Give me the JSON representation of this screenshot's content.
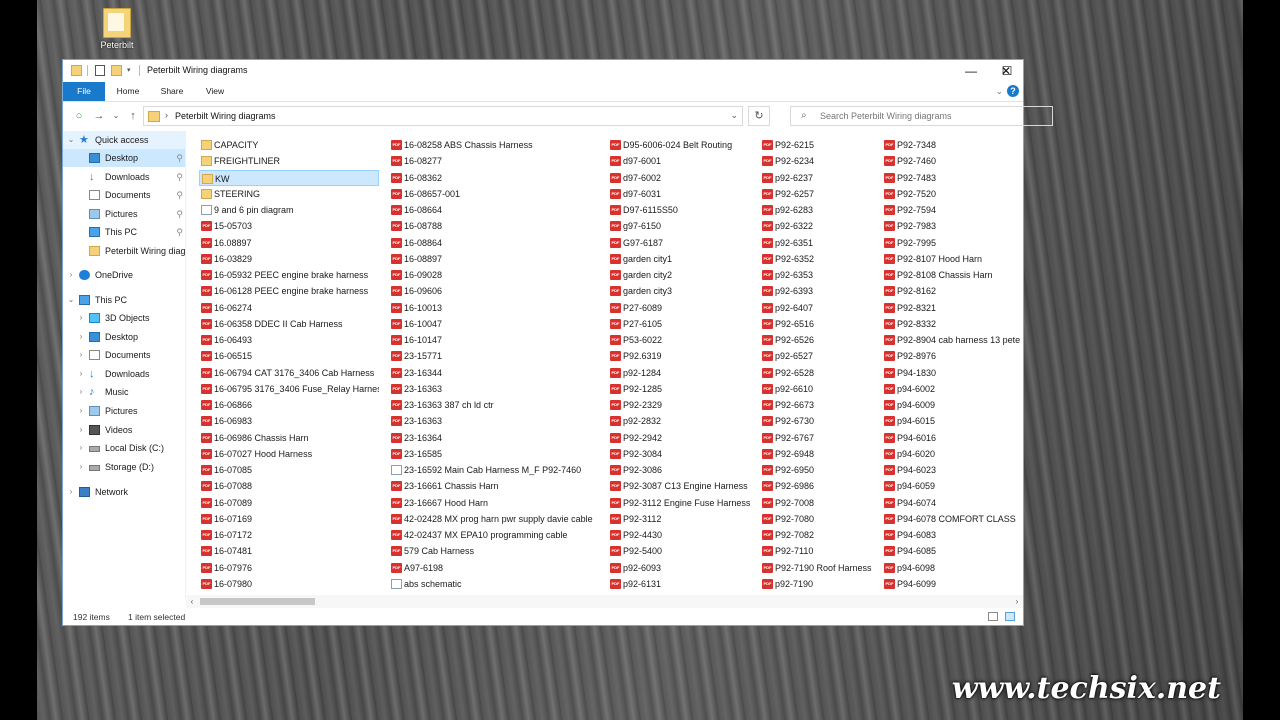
{
  "desktop": {
    "icon_label": "Peterbilt",
    "watermark": "www.techsix.net"
  },
  "window": {
    "title": "Peterbilt Wiring diagrams",
    "buttons": [
      "—",
      "☐",
      "✕"
    ]
  },
  "ribbon": {
    "tabs": [
      "File",
      "Home",
      "Share",
      "View"
    ]
  },
  "address_bar": {
    "path": "Peterbilt Wiring diagrams",
    "search_placeholder": "Search Peterbilt Wiring diagrams"
  },
  "nav_pane": {
    "items": [
      {
        "label": "Quick access",
        "icon": "star-icon",
        "level": 0,
        "state": "expanded",
        "pinned": false
      },
      {
        "label": "Desktop",
        "icon": "desktop-icon",
        "level": 1,
        "state": "",
        "pinned": true,
        "selected": true
      },
      {
        "label": "Downloads",
        "icon": "download-icon",
        "level": 1,
        "state": "",
        "pinned": true
      },
      {
        "label": "Documents",
        "icon": "documents-icon",
        "level": 1,
        "state": "",
        "pinned": true
      },
      {
        "label": "Pictures",
        "icon": "pictures-icon",
        "level": 1,
        "state": "",
        "pinned": true
      },
      {
        "label": "This PC",
        "icon": "pc-icon",
        "level": 1,
        "state": "",
        "pinned": true
      },
      {
        "label": "Peterbilt Wiring diagrams",
        "icon": "folder-icon",
        "level": 1,
        "state": "",
        "pinned": false
      },
      {
        "label": "OneDrive",
        "icon": "cloud-icon",
        "level": 0,
        "state": "collapsed",
        "pinned": false
      },
      {
        "label": "This PC",
        "icon": "pc-icon",
        "level": 0,
        "state": "expanded",
        "pinned": false
      },
      {
        "label": "3D Objects",
        "icon": "3d-objects-icon",
        "level": 1,
        "state": "collapsed",
        "pinned": false
      },
      {
        "label": "Desktop",
        "icon": "desktop-icon",
        "level": 1,
        "state": "collapsed",
        "pinned": false
      },
      {
        "label": "Documents",
        "icon": "documents-icon",
        "level": 1,
        "state": "collapsed",
        "pinned": false
      },
      {
        "label": "Downloads",
        "icon": "download-icon",
        "level": 1,
        "state": "collapsed",
        "pinned": false
      },
      {
        "label": "Music",
        "icon": "music-icon",
        "level": 1,
        "state": "collapsed",
        "pinned": false
      },
      {
        "label": "Pictures",
        "icon": "pictures-icon",
        "level": 1,
        "state": "collapsed",
        "pinned": false
      },
      {
        "label": "Videos",
        "icon": "videos-icon",
        "level": 1,
        "state": "collapsed",
        "pinned": false
      },
      {
        "label": "Local Disk (C:)",
        "icon": "drive-icon",
        "level": 1,
        "state": "collapsed",
        "pinned": false
      },
      {
        "label": "Storage (D:)",
        "icon": "drive-icon",
        "level": 1,
        "state": "collapsed",
        "pinned": false
      },
      {
        "label": "Network",
        "icon": "network-icon",
        "level": 0,
        "state": "collapsed",
        "pinned": false
      }
    ]
  },
  "content": {
    "columns": [
      [
        {
          "name": "CAPACITY",
          "type": "folder"
        },
        {
          "name": "FREIGHTLINER",
          "type": "folder"
        },
        {
          "name": "KW",
          "type": "folder",
          "selected": true
        },
        {
          "name": "STEERING",
          "type": "folder"
        },
        {
          "name": "9 and 6 pin diagram",
          "type": "file"
        },
        {
          "name": "15-05703",
          "type": "pdf"
        },
        {
          "name": "16.08897",
          "type": "pdf"
        },
        {
          "name": "16-03829",
          "type": "pdf"
        },
        {
          "name": "16-05932 PEEC engine brake harness",
          "type": "pdf"
        },
        {
          "name": "16-06128 PEEC engine brake harness",
          "type": "pdf"
        },
        {
          "name": "16-06274",
          "type": "pdf"
        },
        {
          "name": "16-06358 DDEC II Cab Harness",
          "type": "pdf"
        },
        {
          "name": "16-06493",
          "type": "pdf"
        },
        {
          "name": "16-06515",
          "type": "pdf"
        },
        {
          "name": "16-06794 CAT 3176_3406 Cab Harness",
          "type": "pdf"
        },
        {
          "name": "16-06795 3176_3406 Fuse_Relay Harness",
          "type": "pdf"
        },
        {
          "name": "16-06866",
          "type": "pdf"
        },
        {
          "name": "16-06983",
          "type": "pdf"
        },
        {
          "name": "16-06986 Chassis Harn",
          "type": "pdf"
        },
        {
          "name": "16-07027 Hood Harness",
          "type": "pdf"
        },
        {
          "name": "16-07085",
          "type": "pdf"
        },
        {
          "name": "16-07088",
          "type": "pdf"
        },
        {
          "name": "16-07089",
          "type": "pdf"
        },
        {
          "name": "16-07169",
          "type": "pdf"
        },
        {
          "name": "16-07172",
          "type": "pdf"
        },
        {
          "name": "16-07481",
          "type": "pdf"
        },
        {
          "name": "16-07976",
          "type": "pdf"
        },
        {
          "name": "16-07980",
          "type": "pdf"
        }
      ],
      [
        {
          "name": "16-08258 ABS Chassis Harness",
          "type": "pdf"
        },
        {
          "name": "16-08277",
          "type": "pdf"
        },
        {
          "name": "16-08362",
          "type": "pdf"
        },
        {
          "name": "16-08657-001",
          "type": "pdf"
        },
        {
          "name": "16-08664",
          "type": "pdf"
        },
        {
          "name": "16-08788",
          "type": "pdf"
        },
        {
          "name": "16-08864",
          "type": "pdf"
        },
        {
          "name": "16-08897",
          "type": "pdf"
        },
        {
          "name": "16-09028",
          "type": "pdf"
        },
        {
          "name": "16-09606",
          "type": "pdf"
        },
        {
          "name": "16-10013",
          "type": "pdf"
        },
        {
          "name": "16-10047",
          "type": "pdf"
        },
        {
          "name": "16-10147",
          "type": "pdf"
        },
        {
          "name": "23-15771",
          "type": "pdf"
        },
        {
          "name": "23-16344",
          "type": "pdf"
        },
        {
          "name": "23-16363",
          "type": "pdf"
        },
        {
          "name": "23-16363 387 ch ld ctr",
          "type": "pdf"
        },
        {
          "name": "23-16363",
          "type": "pdf"
        },
        {
          "name": "23-16364",
          "type": "pdf"
        },
        {
          "name": "23-16585",
          "type": "pdf"
        },
        {
          "name": "23-16592 Main Cab Harness M_F P92-7460",
          "type": "file"
        },
        {
          "name": "23-16661 Chassis Harn",
          "type": "pdf"
        },
        {
          "name": "23-16667 Hood Harn",
          "type": "pdf"
        },
        {
          "name": "42-02428 MX prog harn pwr supply davie cable",
          "type": "pdf"
        },
        {
          "name": "42-02437 MX EPA10 programming cable",
          "type": "pdf"
        },
        {
          "name": "579 Cab Harness",
          "type": "pdf"
        },
        {
          "name": "A97-6198",
          "type": "pdf"
        },
        {
          "name": "abs schematic",
          "type": "file"
        }
      ],
      [
        {
          "name": "D95-6006-024 Belt Routing",
          "type": "pdf"
        },
        {
          "name": "d97-6001",
          "type": "pdf"
        },
        {
          "name": "d97-6002",
          "type": "pdf"
        },
        {
          "name": "d97-6031",
          "type": "pdf"
        },
        {
          "name": "D97-6115S50",
          "type": "pdf"
        },
        {
          "name": "g97-6150",
          "type": "pdf"
        },
        {
          "name": "G97-6187",
          "type": "pdf"
        },
        {
          "name": "garden city1",
          "type": "pdf"
        },
        {
          "name": "garden city2",
          "type": "pdf"
        },
        {
          "name": "garden city3",
          "type": "pdf"
        },
        {
          "name": "P27-6089",
          "type": "pdf"
        },
        {
          "name": "P27-6105",
          "type": "pdf"
        },
        {
          "name": "P53-6022",
          "type": "pdf"
        },
        {
          "name": "P92.6319",
          "type": "pdf"
        },
        {
          "name": "p92-1284",
          "type": "pdf"
        },
        {
          "name": "P92-1285",
          "type": "pdf"
        },
        {
          "name": "P92-2329",
          "type": "pdf"
        },
        {
          "name": "p92-2832",
          "type": "pdf"
        },
        {
          "name": "P92-2942",
          "type": "pdf"
        },
        {
          "name": "P92-3084",
          "type": "pdf"
        },
        {
          "name": "P92-3086",
          "type": "pdf"
        },
        {
          "name": "P92-3087 C13 Engine Harness",
          "type": "pdf"
        },
        {
          "name": "P92-3112 Engine Fuse Harness",
          "type": "pdf"
        },
        {
          "name": "P92-3112",
          "type": "pdf"
        },
        {
          "name": "P92-4430",
          "type": "pdf"
        },
        {
          "name": "P92-5400",
          "type": "pdf"
        },
        {
          "name": "p92-6093",
          "type": "pdf"
        },
        {
          "name": "p92-6131",
          "type": "pdf"
        }
      ],
      [
        {
          "name": "P92-6215",
          "type": "pdf"
        },
        {
          "name": "P92-6234",
          "type": "pdf"
        },
        {
          "name": "p92-6237",
          "type": "pdf"
        },
        {
          "name": "P92-6257",
          "type": "pdf"
        },
        {
          "name": "p92-6283",
          "type": "pdf"
        },
        {
          "name": "p92-6322",
          "type": "pdf"
        },
        {
          "name": "p92-6351",
          "type": "pdf"
        },
        {
          "name": "P92-6352",
          "type": "pdf"
        },
        {
          "name": "p92-6353",
          "type": "pdf"
        },
        {
          "name": "p92-6393",
          "type": "pdf"
        },
        {
          "name": "p92-6407",
          "type": "pdf"
        },
        {
          "name": "P92-6516",
          "type": "pdf"
        },
        {
          "name": "P92-6526",
          "type": "pdf"
        },
        {
          "name": "p92-6527",
          "type": "pdf"
        },
        {
          "name": "P92-6528",
          "type": "pdf"
        },
        {
          "name": "p92-6610",
          "type": "pdf"
        },
        {
          "name": "P92-6673",
          "type": "pdf"
        },
        {
          "name": "P92-6730",
          "type": "pdf"
        },
        {
          "name": "P92-6767",
          "type": "pdf"
        },
        {
          "name": "P92-6948",
          "type": "pdf"
        },
        {
          "name": "P92-6950",
          "type": "pdf"
        },
        {
          "name": "P92-6986",
          "type": "pdf"
        },
        {
          "name": "P92-7008",
          "type": "pdf"
        },
        {
          "name": "P92-7080",
          "type": "pdf"
        },
        {
          "name": "P92-7082",
          "type": "pdf"
        },
        {
          "name": "P92-7110",
          "type": "pdf"
        },
        {
          "name": "P92-7190 Roof Harness",
          "type": "pdf"
        },
        {
          "name": "p92-7190",
          "type": "pdf"
        }
      ],
      [
        {
          "name": "P92-7348",
          "type": "pdf"
        },
        {
          "name": "P92-7460",
          "type": "pdf"
        },
        {
          "name": "P92-7483",
          "type": "pdf"
        },
        {
          "name": "P92-7520",
          "type": "pdf"
        },
        {
          "name": "P92-7594",
          "type": "pdf"
        },
        {
          "name": "P92-7983",
          "type": "pdf"
        },
        {
          "name": "P92-7995",
          "type": "pdf"
        },
        {
          "name": "P92-8107 Hood Harn",
          "type": "pdf"
        },
        {
          "name": "P92-8108 Chassis Harn",
          "type": "pdf"
        },
        {
          "name": "P92-8162",
          "type": "pdf"
        },
        {
          "name": "P92-8321",
          "type": "pdf"
        },
        {
          "name": "P92-8332",
          "type": "pdf"
        },
        {
          "name": "P92-8904 cab harness 13 pete",
          "type": "pdf"
        },
        {
          "name": "P92-8976",
          "type": "pdf"
        },
        {
          "name": "P94-1830",
          "type": "pdf"
        },
        {
          "name": "p94-6002",
          "type": "pdf"
        },
        {
          "name": "p94-6009",
          "type": "pdf"
        },
        {
          "name": "p94-6015",
          "type": "pdf"
        },
        {
          "name": "P94-6016",
          "type": "pdf"
        },
        {
          "name": "p94-6020",
          "type": "pdf"
        },
        {
          "name": "P94-6023",
          "type": "pdf"
        },
        {
          "name": "p94-6059",
          "type": "pdf"
        },
        {
          "name": "P94-6074",
          "type": "pdf"
        },
        {
          "name": "P94-6078 COMFORT CLASS",
          "type": "pdf"
        },
        {
          "name": "P94-6083",
          "type": "pdf"
        },
        {
          "name": "P94-6085",
          "type": "pdf"
        },
        {
          "name": "p94-6098",
          "type": "pdf"
        },
        {
          "name": "P94-6099",
          "type": "pdf"
        }
      ]
    ]
  },
  "status_bar": {
    "item_count": "192 items",
    "selection": "1 item selected"
  }
}
